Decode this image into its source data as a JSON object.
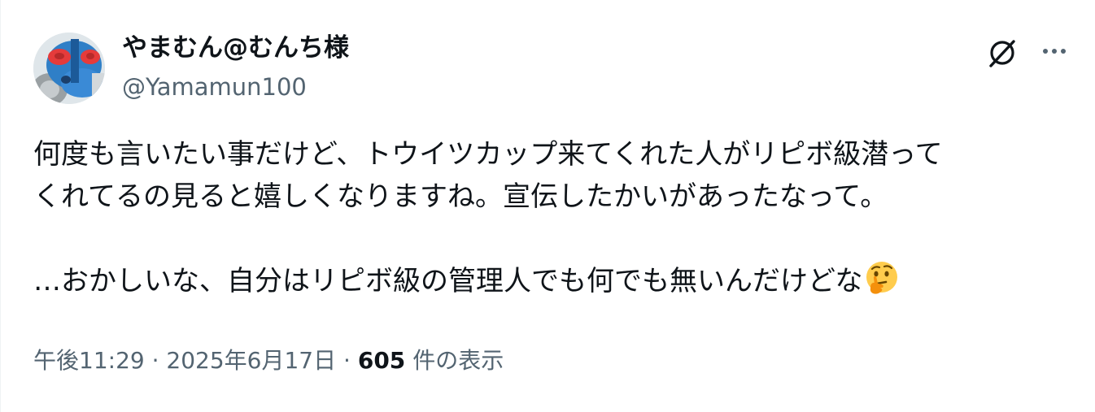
{
  "author": {
    "display_name": "やまむん@むんち様",
    "handle": "@Yamamun100"
  },
  "header_actions": {
    "grok_icon": "grok-slash-circle-icon",
    "more_icon": "more-horizontal-dots-icon"
  },
  "tweet": {
    "lines": [
      "何度も言いたい事だけど、トウイツカップ来てくれた人がリピボ級潜って",
      "くれてるの見ると嬉しくなりますね。宣伝したかいがあったなって。",
      "",
      "…おかしいな、自分はリピボ級の管理人でも何でも無いんだけどな"
    ],
    "emoji": "thinking-face-emoji"
  },
  "meta": {
    "time": "午後11:29",
    "separator": "·",
    "date": "2025年6月17日",
    "views_count": "605",
    "views_label": "件の表示"
  },
  "colors": {
    "text_primary": "#0f1419",
    "text_secondary": "#536471",
    "border": "#eff3f4"
  }
}
